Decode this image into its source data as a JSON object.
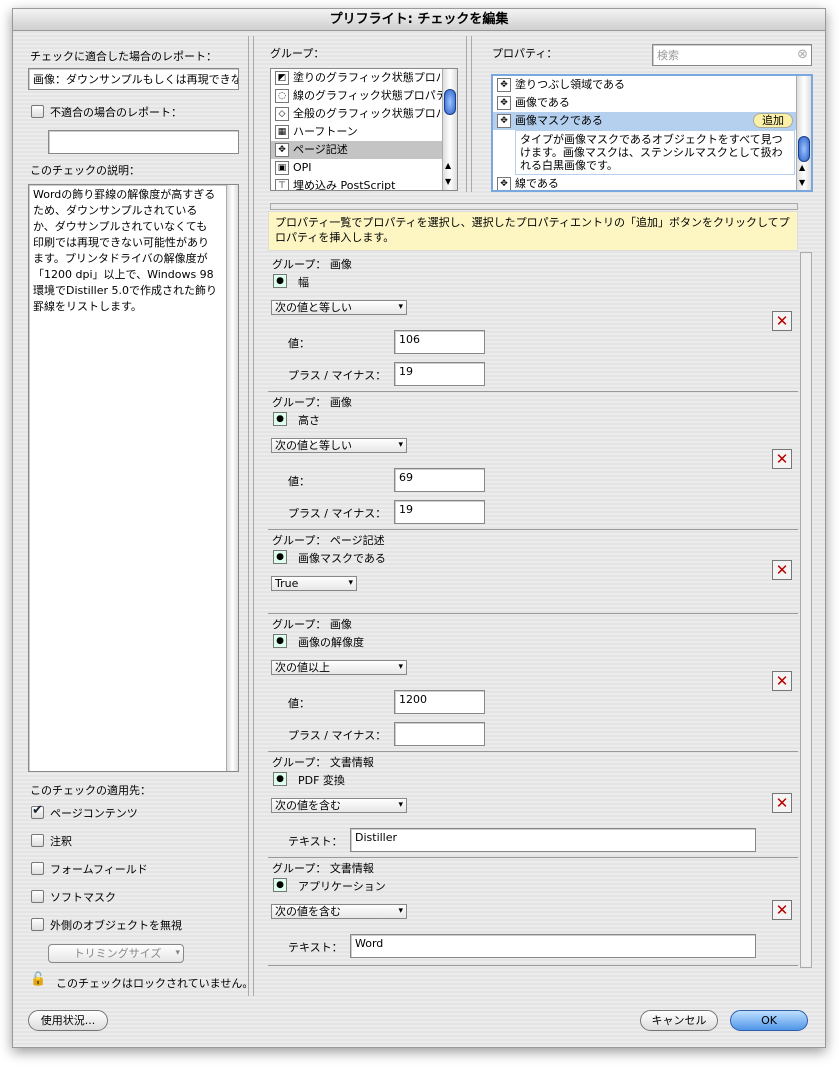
{
  "window": {
    "title": "プリフライト: チェックを編集"
  },
  "left": {
    "match_report_label": "チェックに適合した場合のレポート：",
    "match_report_value": "画像：ダウンサンプルもしくは再現できな",
    "nomatch_label": "不適合の場合のレポート：",
    "nomatch_value": "",
    "description_label": "このチェックの説明：",
    "description": "Wordの飾り罫線の解像度が高すぎるため、ダウンサンプルされているか、ダウサンプルされていなくても印刷では再現できない可能性があります。プリンタドライバの解像度が「1200 dpi」以上で、Windows 98環境でDistiller 5.0で作成された飾り罫線をリストします。",
    "applies_label": "このチェックの適用先：",
    "applies": [
      {
        "label": "ページコンテンツ",
        "checked": true
      },
      {
        "label": "注釈",
        "checked": false
      },
      {
        "label": "フォームフィールド",
        "checked": false
      },
      {
        "label": "ソフトマスク",
        "checked": false
      },
      {
        "label": "外側のオブジェクトを無視",
        "checked": false
      }
    ],
    "trim_select": "トリミングサイズ",
    "lock_text": "このチェックはロックされていません。",
    "usage_button": "使用状況..."
  },
  "groups": {
    "label": "グループ：",
    "items": [
      {
        "label": "塗りのグラフィック状態プロパ",
        "icon": "fill-state-icon"
      },
      {
        "label": "線のグラフィック状態プロパテ",
        "icon": "stroke-state-icon"
      },
      {
        "label": "全般のグラフィック状態プロパ",
        "icon": "graphic-state-icon"
      },
      {
        "label": "ハーフトーン",
        "icon": "halftone-icon"
      },
      {
        "label": "ページ記述",
        "icon": "page-description-icon",
        "selected": true
      },
      {
        "label": "OPI",
        "icon": "opi-icon"
      },
      {
        "label": "埋め込み PostScript",
        "icon": "postscript-icon"
      }
    ]
  },
  "properties": {
    "label": "プロパティ：",
    "search_placeholder": "検索",
    "items": [
      {
        "label": "塗りつぶし領域である"
      },
      {
        "label": "画像である"
      },
      {
        "label": "画像マスクである",
        "selected": true,
        "add": "追加",
        "desc": "タイプが画像マスクであるオブジェクトをすべて見つけます。画像マスクは、ステンシルマスクとして扱われる白黒画像です。"
      },
      {
        "label": "線である"
      }
    ]
  },
  "tip": "プロパティ一覧でプロパティを選択し、選択したプロパティエントリの「追加」ボタンをクリックしてプロパティを挿入します。",
  "criteria": [
    {
      "group": "グループ： 画像",
      "property": "幅",
      "operator": "次の値と等しい",
      "fields": [
        {
          "label": "値：",
          "value": "106"
        },
        {
          "label": "プラス / マイナス：",
          "value": "19"
        }
      ]
    },
    {
      "group": "グループ： 画像",
      "property": "高さ",
      "operator": "次の値と等しい",
      "fields": [
        {
          "label": "値：",
          "value": "69"
        },
        {
          "label": "プラス / マイナス：",
          "value": "19"
        }
      ]
    },
    {
      "group": "グループ： ページ記述",
      "property": "画像マスクである",
      "operator": "True",
      "fields": []
    },
    {
      "group": "グループ： 画像",
      "property": "画像の解像度",
      "operator": "次の値以上",
      "fields": [
        {
          "label": "値：",
          "value": "1200"
        },
        {
          "label": "プラス / マイナス：",
          "value": ""
        }
      ]
    },
    {
      "group": "グループ： 文書情報",
      "property": "PDF 変換",
      "operator": "次の値を含む",
      "text": {
        "label": "テキスト：",
        "value": "Distiller"
      }
    },
    {
      "group": "グループ： 文書情報",
      "property": "アプリケーション",
      "operator": "次の値を含む",
      "text": {
        "label": "テキスト：",
        "value": "Word"
      }
    }
  ],
  "footer": {
    "cancel": "キャンセル",
    "ok": "OK"
  }
}
